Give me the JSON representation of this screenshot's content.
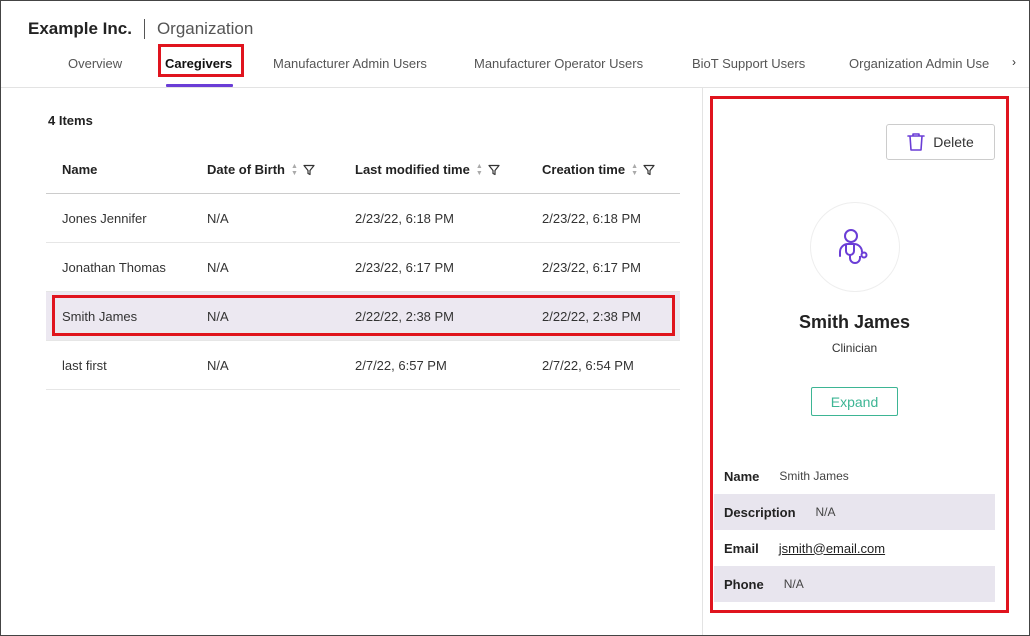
{
  "header": {
    "company": "Example Inc.",
    "section": "Organization"
  },
  "tabs": [
    {
      "label": "Overview",
      "active": false
    },
    {
      "label": "Caregivers",
      "active": true
    },
    {
      "label": "Manufacturer Admin Users",
      "active": false
    },
    {
      "label": "Manufacturer Operator Users",
      "active": false
    },
    {
      "label": "BioT Support Users",
      "active": false
    },
    {
      "label": "Organization Admin Use",
      "active": false
    }
  ],
  "tabs_more_icon": "chevron-right-icon",
  "list": {
    "count_label": "4 Items",
    "columns": [
      "Name",
      "Date of Birth",
      "Last modified time",
      "Creation time"
    ],
    "rows": [
      {
        "name": "Jones Jennifer",
        "dob": "N/A",
        "modified": "2/23/22, 6:18 PM",
        "created": "2/23/22, 6:18 PM",
        "selected": false
      },
      {
        "name": "Jonathan Thomas",
        "dob": "N/A",
        "modified": "2/23/22, 6:17 PM",
        "created": "2/23/22, 6:17 PM",
        "selected": false
      },
      {
        "name": "Smith James",
        "dob": "N/A",
        "modified": "2/22/22, 2:38 PM",
        "created": "2/22/22, 2:38 PM",
        "selected": true
      },
      {
        "name": "last first",
        "dob": "N/A",
        "modified": "2/7/22, 6:57 PM",
        "created": "2/7/22, 6:54 PM",
        "selected": false
      }
    ]
  },
  "details": {
    "delete_label": "Delete",
    "avatar_icon": "clinician-icon",
    "name": "Smith James",
    "role": "Clinician",
    "expand_label": "Expand",
    "fields": {
      "name": {
        "label": "Name",
        "value": "Smith James"
      },
      "description": {
        "label": "Description",
        "value": "N/A"
      },
      "email": {
        "label": "Email",
        "value": "jsmith@email.com"
      },
      "phone": {
        "label": "Phone",
        "value": "N/A"
      }
    }
  },
  "colors": {
    "accent": "#6a3dd6",
    "highlight": "#e0141e",
    "expand": "#3db594",
    "selected_row": "#ece8f1"
  }
}
